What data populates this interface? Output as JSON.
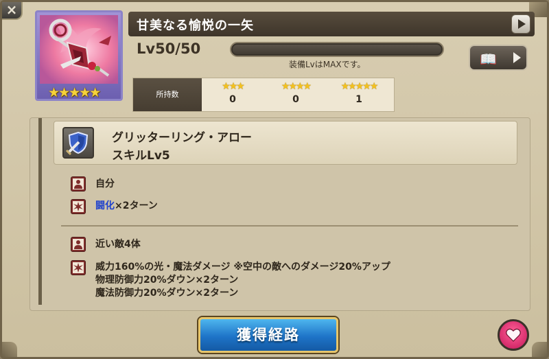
{
  "window": {
    "close_icon": "x-icon"
  },
  "item": {
    "icon": "crossbow-weapon-icon",
    "rarity": 5,
    "rarity_stars": "★★★★★",
    "title": "甘美なる愉悦の一矢",
    "level_text": "Lv50/50",
    "level_progress": 1.0,
    "max_note": "装備LvはMAXです。"
  },
  "buttons": {
    "title_next_icon": "play-icon",
    "book_icon": "book-quill-icon",
    "book_arrow_icon": "play-icon",
    "obtain_label": "獲得経路",
    "favorite_icon": "heart-icon"
  },
  "owned": {
    "label": "所持数",
    "columns": [
      {
        "stars": "★★★",
        "count": "0"
      },
      {
        "stars": "★★★★",
        "count": "0"
      },
      {
        "stars": "★★★★★",
        "count": "1"
      }
    ]
  },
  "skill": {
    "icon": "shield-sword-icon",
    "name": "グリッターリング・アロー",
    "level": "スキルLv5",
    "groups": [
      {
        "target": "自分",
        "effect_word": "闘化",
        "effect_rest": "×2ターン"
      },
      {
        "target": "近い敵4体",
        "lines": [
          "威力160%の光・魔法ダメージ ※空中の敵へのダメージ20%アップ",
          "物理防御力20%ダウン×2ターン",
          "魔法防御力20%ダウン×2ターン"
        ]
      }
    ]
  },
  "colors": {
    "accent_blue": "#1e74c8",
    "gold_border": "#e7c66b",
    "debuff_word": "#2244cc",
    "favorite_pink": "#e0306f",
    "effect_icon_red": "#7f2d2b"
  }
}
